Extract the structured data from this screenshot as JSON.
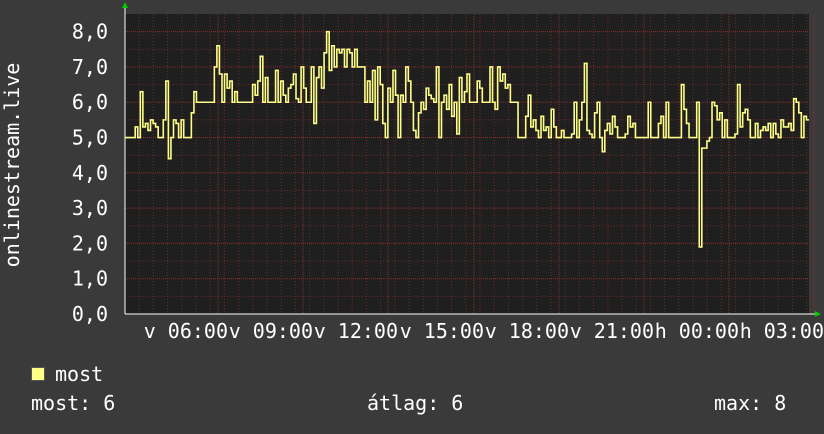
{
  "chart_data": {
    "type": "line",
    "ylabel": "onlinestream.live",
    "ylim": [
      0,
      8.5
    ],
    "yticks": [
      "0,0",
      "1,0",
      "2,0",
      "3,0",
      "4,0",
      "5,0",
      "6,0",
      "7,0",
      "8,0"
    ],
    "xticks": [
      "v 06:00",
      "v 09:00",
      "v 12:00",
      "v 15:00",
      "v 18:00",
      "v 21:00",
      "h 00:00",
      "h 03:00"
    ],
    "grid": true,
    "colors": {
      "background": "#3a3a3a",
      "plot": "#1f1f1f",
      "line": "#ffff88",
      "grid": "#5a2a2a",
      "axis_arrow": "#00cc00"
    },
    "series": [
      {
        "name": "most",
        "values": [
          5,
          5,
          5,
          5,
          5.3,
          5,
          6.3,
          5.3,
          5.4,
          5.2,
          5.5,
          5.4,
          5.3,
          5,
          5,
          5.5,
          6.6,
          4.4,
          5,
          5.5,
          5.4,
          5,
          5.5,
          5,
          5,
          5,
          5.7,
          6.3,
          6,
          6,
          6,
          6,
          6,
          6,
          6,
          7,
          7.6,
          6.8,
          6,
          6.8,
          6.4,
          6.6,
          6,
          6.3,
          6,
          6,
          6,
          6,
          6,
          6,
          6.5,
          6.2,
          6.6,
          7.3,
          6,
          6.7,
          6,
          6,
          6,
          6.9,
          6,
          6.6,
          6.2,
          6,
          6.4,
          6.5,
          6.8,
          6.1,
          6,
          7,
          6.4,
          6,
          6,
          7,
          5.4,
          6.7,
          7,
          6.4,
          7.4,
          8,
          6.9,
          7.6,
          7,
          7.5,
          7.4,
          7.5,
          7,
          7.5,
          7.4,
          7,
          7.5,
          7,
          7,
          7,
          6,
          6.6,
          6,
          6.9,
          5.5,
          7,
          6.5,
          5.4,
          5,
          6.4,
          6,
          6.9,
          6.2,
          5,
          6.2,
          6,
          7,
          6.6,
          6,
          5.2,
          5,
          5.7,
          6,
          5.8,
          6.4,
          6.2,
          6.1,
          6,
          7,
          5,
          6,
          6.2,
          5.8,
          6.5,
          5.6,
          6,
          5.1,
          6.7,
          6,
          6.3,
          6.8,
          6,
          6,
          6,
          6.6,
          6.4,
          6,
          6,
          6,
          7,
          6,
          5.8,
          7,
          6.6,
          6.8,
          6.4,
          6.5,
          6,
          6,
          6,
          5,
          5,
          5,
          5.6,
          6.2,
          5.3,
          5.5,
          5.2,
          5,
          5.6,
          5.2,
          5.3,
          5,
          5.8,
          5.3,
          5,
          5,
          5.2,
          5,
          5,
          5,
          5.1,
          6,
          5,
          5.5,
          6,
          7.1,
          5.2,
          5.1,
          5,
          5.7,
          6,
          5,
          4.6,
          5.2,
          5.4,
          5.1,
          5.6,
          5.3,
          5,
          5,
          5,
          5.1,
          5.6,
          5.3,
          5.4,
          5,
          5,
          5,
          5,
          5,
          6,
          5,
          5,
          5,
          5.4,
          5.6,
          5,
          6,
          5,
          5,
          5,
          5,
          5,
          6.5,
          5.8,
          5.4,
          5,
          5,
          5,
          6,
          1.9,
          4.7,
          4.7,
          4.9,
          5,
          6,
          5.9,
          5.5,
          5.7,
          5,
          5.5,
          5,
          5,
          5,
          5.1,
          6.5,
          5.3,
          5.7,
          5.8,
          5.5,
          5,
          5,
          5.4,
          5,
          5.2,
          5.3,
          5.2,
          5.4,
          5,
          5.4,
          5.1,
          5,
          5.5,
          5.3,
          5.3,
          5.4,
          5.2,
          6.1,
          6,
          5.7,
          5,
          5.6,
          5.5
        ]
      }
    ]
  },
  "legend": {
    "label": "most",
    "color": "#ffff88"
  },
  "stats": {
    "current": "most: 6",
    "average": "átlag: 6",
    "max": "max: 8"
  }
}
